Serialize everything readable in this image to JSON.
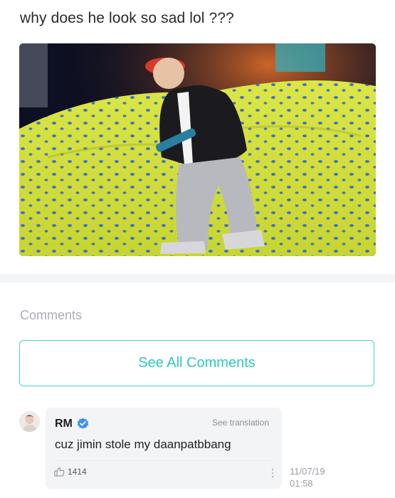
{
  "post": {
    "title": "why does he look so sad lol ???"
  },
  "comments_section": {
    "heading": "Comments",
    "see_all_label": "See All Comments"
  },
  "comment": {
    "author": "RM",
    "verified_icon": "verified-check-icon",
    "see_translation_label": "See translation",
    "text": "cuz jimin stole my daanpatbbang",
    "likes": "1414",
    "like_icon": "thumbs-up-icon",
    "more_icon": "vertical-ellipsis-icon",
    "date": "11/07/19",
    "time": "01:58"
  },
  "colors": {
    "accent": "#2ec9bb",
    "verified": "#3b8ef3",
    "muted_text": "#a9adb5",
    "bubble_bg": "#f3f4f6"
  }
}
